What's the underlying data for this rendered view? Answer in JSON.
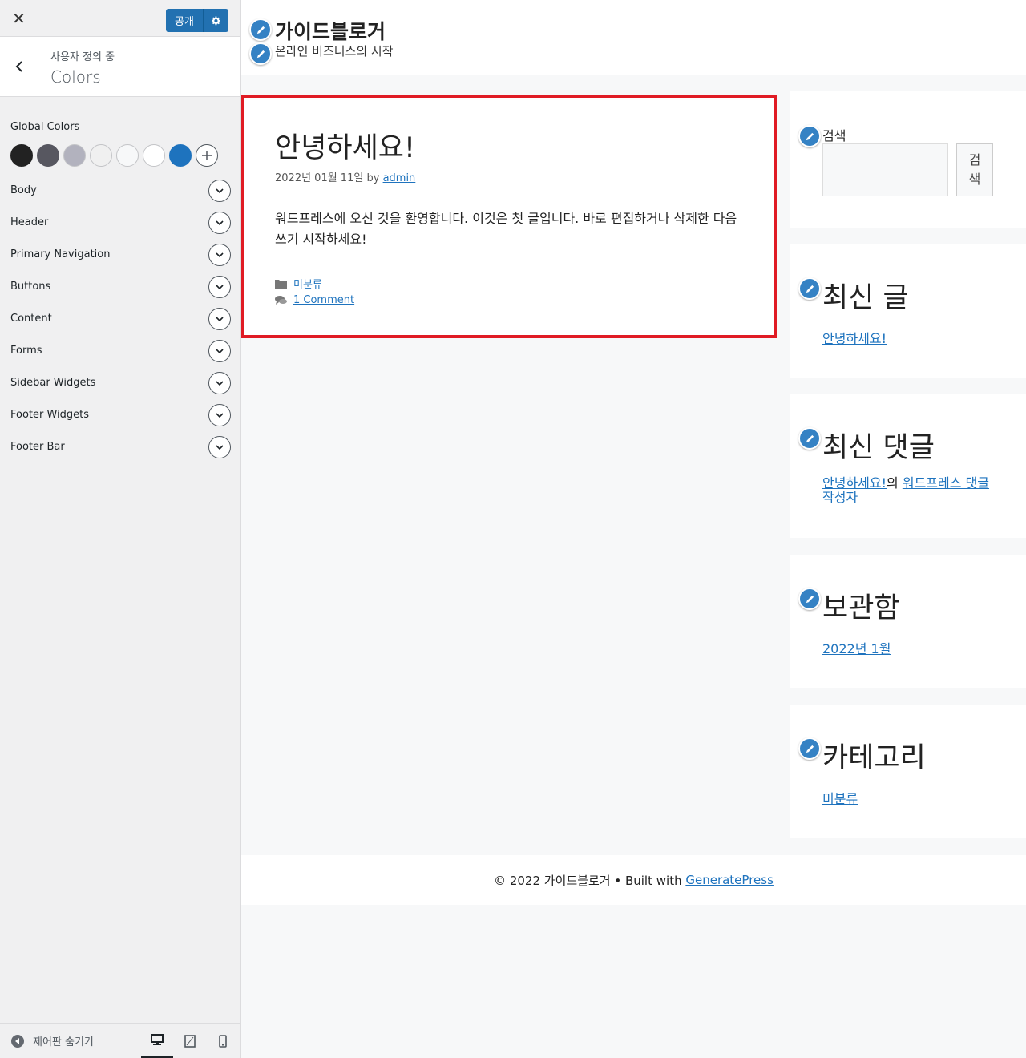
{
  "customizer": {
    "close_glyph": "✕",
    "publish_label": "공개",
    "section": {
      "breadcrumb": "사용자 정의 중",
      "title": "Colors"
    },
    "global_colors_label": "Global Colors",
    "global_colors": [
      "#222222",
      "#575760",
      "#b2b2be",
      "#f0f0f0",
      "#f7f8f9",
      "#ffffff",
      "#1e73be"
    ],
    "rows": [
      {
        "label": "Body"
      },
      {
        "label": "Header"
      },
      {
        "label": "Primary Navigation"
      },
      {
        "label": "Buttons"
      },
      {
        "label": "Content"
      },
      {
        "label": "Forms"
      },
      {
        "label": "Sidebar Widgets"
      },
      {
        "label": "Footer Widgets"
      },
      {
        "label": "Footer Bar"
      }
    ],
    "footer": {
      "hide_label": "제어판 숨기기",
      "devices": [
        "desktop",
        "tablet",
        "mobile"
      ],
      "active_device": "desktop"
    }
  },
  "site": {
    "title": "가이드블로거",
    "tagline": "온라인 비즈니스의 시작",
    "post": {
      "title": "안녕하세요!",
      "date": "2022년 01월 11일",
      "by": "by",
      "author": "admin",
      "body": "워드프레스에 오신 것을 환영합니다. 이것은 첫 글입니다. 바로 편집하거나 삭제한 다음 쓰기 시작하세요!",
      "category": "미분류",
      "comments": "1 Comment"
    },
    "widgets": {
      "search": {
        "label": "검색",
        "button": "검색"
      },
      "recent_posts": {
        "title": "최신 글",
        "items": [
          "안녕하세요!"
        ]
      },
      "recent_comments": {
        "title": "최신 댓글",
        "post_link": "안녕하세요!",
        "connector": "의",
        "author_link": "워드프레스 댓글 작성자"
      },
      "archives": {
        "title": "보관함",
        "items": [
          "2022년 1월"
        ]
      },
      "categories": {
        "title": "카테고리",
        "items": [
          "미분류"
        ]
      }
    },
    "footer": {
      "copyright": "© 2022 가이드블로거 • Built with",
      "link": "GeneratePress"
    }
  },
  "colors": {
    "accent": "#2271b1",
    "link": "#1e73be",
    "highlight_border": "#e01b24",
    "edit_bubble": "#3582c4"
  }
}
